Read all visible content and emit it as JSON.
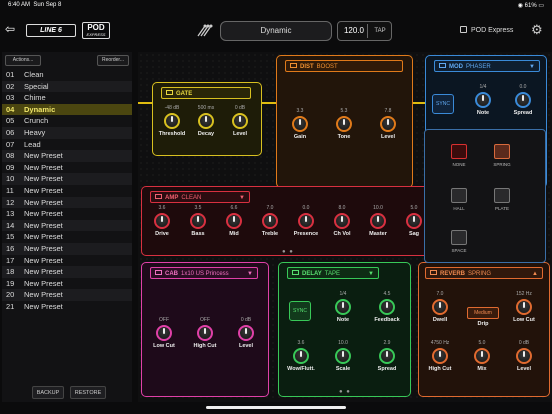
{
  "status": {
    "time": "6:40 AM",
    "date": "Sun Sep 8",
    "battery": "61%"
  },
  "header": {
    "brand": "LINE 6",
    "product": "POD",
    "product_sub": "EXPRESS",
    "preset_name": "Dynamic",
    "tempo": "120.0",
    "tap_label": "TAP",
    "device_name": "POD Express"
  },
  "sidebar": {
    "actions_label": "Actions...",
    "reorder_label": "Reorder...",
    "presets": [
      {
        "num": "01",
        "name": "Clean"
      },
      {
        "num": "02",
        "name": "Special"
      },
      {
        "num": "03",
        "name": "Chime"
      },
      {
        "num": "04",
        "name": "Dynamic"
      },
      {
        "num": "05",
        "name": "Crunch"
      },
      {
        "num": "06",
        "name": "Heavy"
      },
      {
        "num": "07",
        "name": "Lead"
      },
      {
        "num": "08",
        "name": "New Preset"
      },
      {
        "num": "09",
        "name": "New Preset"
      },
      {
        "num": "10",
        "name": "New Preset"
      },
      {
        "num": "11",
        "name": "New Preset"
      },
      {
        "num": "12",
        "name": "New Preset"
      },
      {
        "num": "13",
        "name": "New Preset"
      },
      {
        "num": "14",
        "name": "New Preset"
      },
      {
        "num": "15",
        "name": "New Preset"
      },
      {
        "num": "16",
        "name": "New Preset"
      },
      {
        "num": "17",
        "name": "New Preset"
      },
      {
        "num": "18",
        "name": "New Preset"
      },
      {
        "num": "19",
        "name": "New Preset"
      },
      {
        "num": "20",
        "name": "New Preset"
      },
      {
        "num": "21",
        "name": "New Preset"
      }
    ],
    "active_index": 3,
    "backup_label": "BACKUP",
    "restore_label": "RESTORE"
  },
  "blocks": {
    "gate": {
      "type": "GATE",
      "model": "",
      "knobs": [
        {
          "label": "Threshold",
          "value": "-48 dB"
        },
        {
          "label": "Decay",
          "value": "500 ms"
        },
        {
          "label": "Level",
          "value": "0 dB"
        }
      ]
    },
    "dist": {
      "type": "DIST",
      "model": "BOOST",
      "knobs": [
        {
          "label": "Gain",
          "value": "3.3"
        },
        {
          "label": "Tone",
          "value": "5.3"
        },
        {
          "label": "Level",
          "value": "7.8"
        }
      ]
    },
    "mod": {
      "type": "MOD",
      "model": "PHASER",
      "sync_label": "SYNC",
      "knobs": [
        {
          "label": "Note",
          "value": "1/4"
        },
        {
          "label": "Spread",
          "value": "0.0"
        }
      ]
    },
    "amp": {
      "type": "AMP",
      "model": "CLEAN",
      "knobs": [
        {
          "label": "Drive",
          "value": "3.6"
        },
        {
          "label": "Bass",
          "value": "3.5"
        },
        {
          "label": "Mid",
          "value": "6.6"
        },
        {
          "label": "Treble",
          "value": "7.0"
        },
        {
          "label": "Presence",
          "value": "0.0"
        },
        {
          "label": "Ch Vol",
          "value": "8.0"
        },
        {
          "label": "Master",
          "value": "10.0"
        },
        {
          "label": "Sag",
          "value": "5.0"
        }
      ]
    },
    "cab": {
      "type": "CAB",
      "model": "1x10 US Princess",
      "knobs": [
        {
          "label": "Low Cut",
          "value": "OFF"
        },
        {
          "label": "High Cut",
          "value": "OFF"
        },
        {
          "label": "Level",
          "value": "0 dB"
        }
      ]
    },
    "delay": {
      "type": "DELAY",
      "model": "TAPE",
      "sync_label": "SYNC",
      "knobs": [
        {
          "label": "Note",
          "value": "1/4"
        },
        {
          "label": "Feedback",
          "value": "4.5"
        },
        {
          "label": "Wow/Flutt.",
          "value": "3.6"
        },
        {
          "label": "Scale",
          "value": "10.0"
        },
        {
          "label": "Spread",
          "value": "2.9"
        }
      ]
    },
    "reverb": {
      "type": "REVERB",
      "model": "SPRING",
      "drip_value": "Medium",
      "knobs": [
        {
          "label": "Dwell",
          "value": "7.0"
        },
        {
          "label": "Drip",
          "value": ""
        },
        {
          "label": "Low Cut",
          "value": "152 Hz"
        },
        {
          "label": "High Cut",
          "value": "4750 Hz"
        },
        {
          "label": "Mix",
          "value": "5.0"
        },
        {
          "label": "Level",
          "value": "0 dB"
        }
      ]
    }
  },
  "reverb_picker": {
    "items": [
      {
        "label": "NONE",
        "icon": "none-icon"
      },
      {
        "label": "SPRING",
        "icon": "spring-reverb-icon"
      },
      {
        "label": "HALL",
        "icon": "hall-reverb-icon"
      },
      {
        "label": "PLATE",
        "icon": "plate-reverb-icon"
      },
      {
        "label": "SPACE",
        "icon": "space-reverb-icon"
      }
    ],
    "selected": "SPRING"
  },
  "colors": {
    "gate": "#d8c020",
    "dist": "#e07a1a",
    "mod": "#3a8ad8",
    "amp": "#d83040",
    "cab": "#e040a8",
    "delay": "#38c858",
    "reverb": "#e06a30",
    "active_preset": "#f0e66a"
  }
}
